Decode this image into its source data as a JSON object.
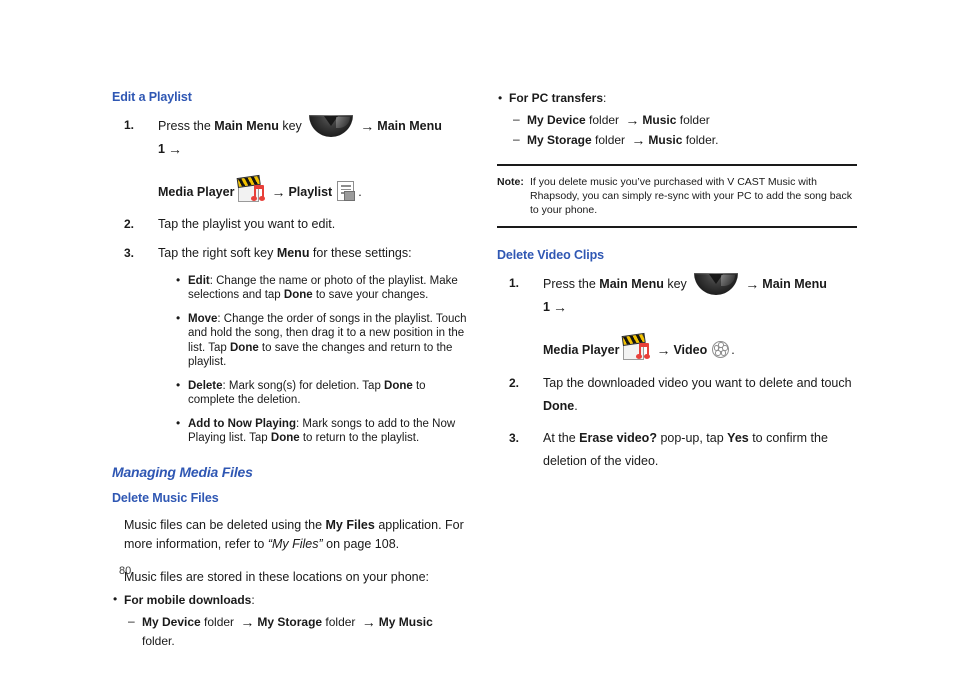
{
  "meta": {
    "page_number": "80",
    "accent_blue": "#2f57b3",
    "text_color": "#1a1a1a"
  },
  "glyphs": {
    "arrow": "→",
    "bullet": "•",
    "dash": "–"
  },
  "icons": {
    "main_menu_key": "main-menu-key-icon",
    "media_player": "media-player-icon",
    "playlist": "playlist-icon",
    "video": "video-reel-icon"
  },
  "left_column": {
    "heading": "Edit a Playlist",
    "step1": {
      "number": "1.",
      "text_before_icon": "Press the ",
      "main_menu_bold": "Main Menu",
      "key_word": " key ",
      "after_key": "Main Menu 1",
      "media_player_label": "Media Player",
      "playlist_label": "Playlist",
      "trailing_period": "."
    },
    "step2": {
      "number": "2.",
      "text": "Tap the playlist you want to edit."
    },
    "step3": {
      "number": "3.",
      "text_a": "Tap the right soft key ",
      "menu_bold": "Menu",
      "text_b": " for these settings:",
      "bullets": [
        {
          "term": "Edit",
          "body_a": ": Change the name or photo of the playlist.  Make selections and tap ",
          "bold_mid": "Done",
          "body_b": " to save your changes."
        },
        {
          "term": "Move",
          "body_a": ": Change the order of songs in the playlist.  Touch and hold the song, then drag it to a new position in the list. Tap ",
          "bold_mid": "Done",
          "body_b": " to save the changes and return to the playlist."
        },
        {
          "term": "Delete",
          "body_a": ": Mark song(s) for deletion.  Tap ",
          "bold_mid": "Done",
          "body_b": " to complete the deletion."
        },
        {
          "term": "Add to Now Playing",
          "body_a": ": Mark songs to add to the Now Playing list. Tap ",
          "bold_mid": "Done",
          "body_b": " to return to the playlist."
        }
      ]
    },
    "major_heading": "Managing Media Files",
    "sub_heading": "Delete Music Files",
    "para1_a": "Music files can be deleted using the ",
    "para1_bold": "My Files",
    "para1_b": " application.  For more information, refer to ",
    "para1_italic": "“My Files”",
    "para1_c": " on page 108.",
    "para2": "Music files are stored in these locations on your phone:",
    "mobile_downloads": {
      "term": "For mobile downloads",
      "colon": ":",
      "path": [
        {
          "bold": "My Device",
          "plain": " folder "
        },
        {
          "bold": "My Storage",
          "plain": " folder "
        },
        {
          "bold": "My Music",
          "plain": " folder."
        }
      ]
    }
  },
  "right_column": {
    "pc_transfers": {
      "term": "For PC transfers",
      "colon": ":",
      "lines": [
        {
          "parts": [
            {
              "bold": "My Device",
              "plain": " folder "
            },
            {
              "bold": "Music",
              "plain": " folder"
            }
          ]
        },
        {
          "parts": [
            {
              "bold": "My Storage",
              "plain": " folder "
            },
            {
              "bold": "Music",
              "plain": " folder."
            }
          ]
        }
      ]
    },
    "note": {
      "label": "Note:",
      "body": "If you delete music you’ve purchased with V CAST Music with Rhapsody, you can simply re-sync with your PC to add the song back to your phone."
    },
    "heading": "Delete Video Clips",
    "step1": {
      "number": "1.",
      "text_before_icon": "Press the ",
      "main_menu_bold": "Main Menu",
      "key_word": " key ",
      "after_key": "Main Menu 1",
      "media_player_label": "Media Player",
      "video_label": "Video",
      "trailing_period": "."
    },
    "step2": {
      "number": "2.",
      "text_a": "Tap the downloaded video you want to delete and touch ",
      "bold": "Done",
      "text_b": "."
    },
    "step3": {
      "number": "3.",
      "text_a": "At the ",
      "bold_a": "Erase video?",
      "text_b": " pop-up, tap ",
      "bold_b": "Yes",
      "text_c": " to confirm the deletion of the video."
    }
  }
}
